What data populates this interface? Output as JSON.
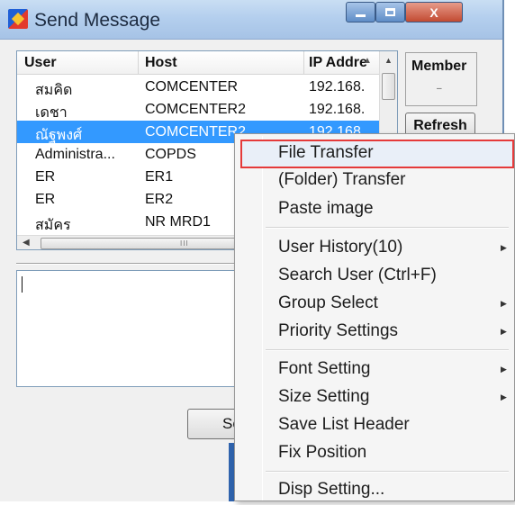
{
  "window": {
    "title": "Send Message",
    "buttons": {
      "minimize": "minimize",
      "maximize": "maximize",
      "close": "X"
    }
  },
  "list": {
    "columns": [
      "User",
      "Host",
      "IP Addre"
    ],
    "rows": [
      {
        "user": "สมคิด",
        "host": "COMCENTER",
        "ip": "192.168."
      },
      {
        "user": "เดชา",
        "host": "COMCENTER2",
        "ip": "192.168."
      },
      {
        "user": "ณัฐพงศ์",
        "host": "COMCENTER2",
        "ip": "192.168.",
        "selected": true
      },
      {
        "user": "Administra...",
        "host": "COPDS",
        "ip": ""
      },
      {
        "user": "ER",
        "host": "ER1",
        "ip": ""
      },
      {
        "user": "ER",
        "host": "ER2",
        "ip": ""
      },
      {
        "user": "สมัคร",
        "host": "NR MRD1",
        "ip": ""
      }
    ],
    "hscroll_grip": "III"
  },
  "side": {
    "member_label": "Member",
    "refresh_label": "Refresh"
  },
  "message": {
    "send_label": "Send"
  },
  "menu": {
    "items": [
      {
        "label": "File Transfer",
        "highlighted": true
      },
      {
        "label": "(Folder) Transfer"
      },
      {
        "label": "Paste image"
      },
      {
        "label": "User History(10)",
        "submenu": true
      },
      {
        "label": "Search User (Ctrl+F)"
      },
      {
        "label": "Group Select",
        "submenu": true
      },
      {
        "label": "Priority Settings",
        "submenu": true
      },
      {
        "label": "Font Setting",
        "submenu": true
      },
      {
        "label": "Size Setting",
        "submenu": true
      },
      {
        "label": "Save List Header"
      },
      {
        "label": "Fix Position"
      },
      {
        "label": "Disp Setting..."
      }
    ]
  },
  "colors": {
    "selection": "#3399ff",
    "menu_highlight_border": "#e53a3a",
    "titlebar": "#b4cfee"
  },
  "icons": [
    "app-icon",
    "sort-up-icon",
    "scroll-up-icon",
    "scroll-left-icon",
    "submenu-arrow-icon"
  ]
}
